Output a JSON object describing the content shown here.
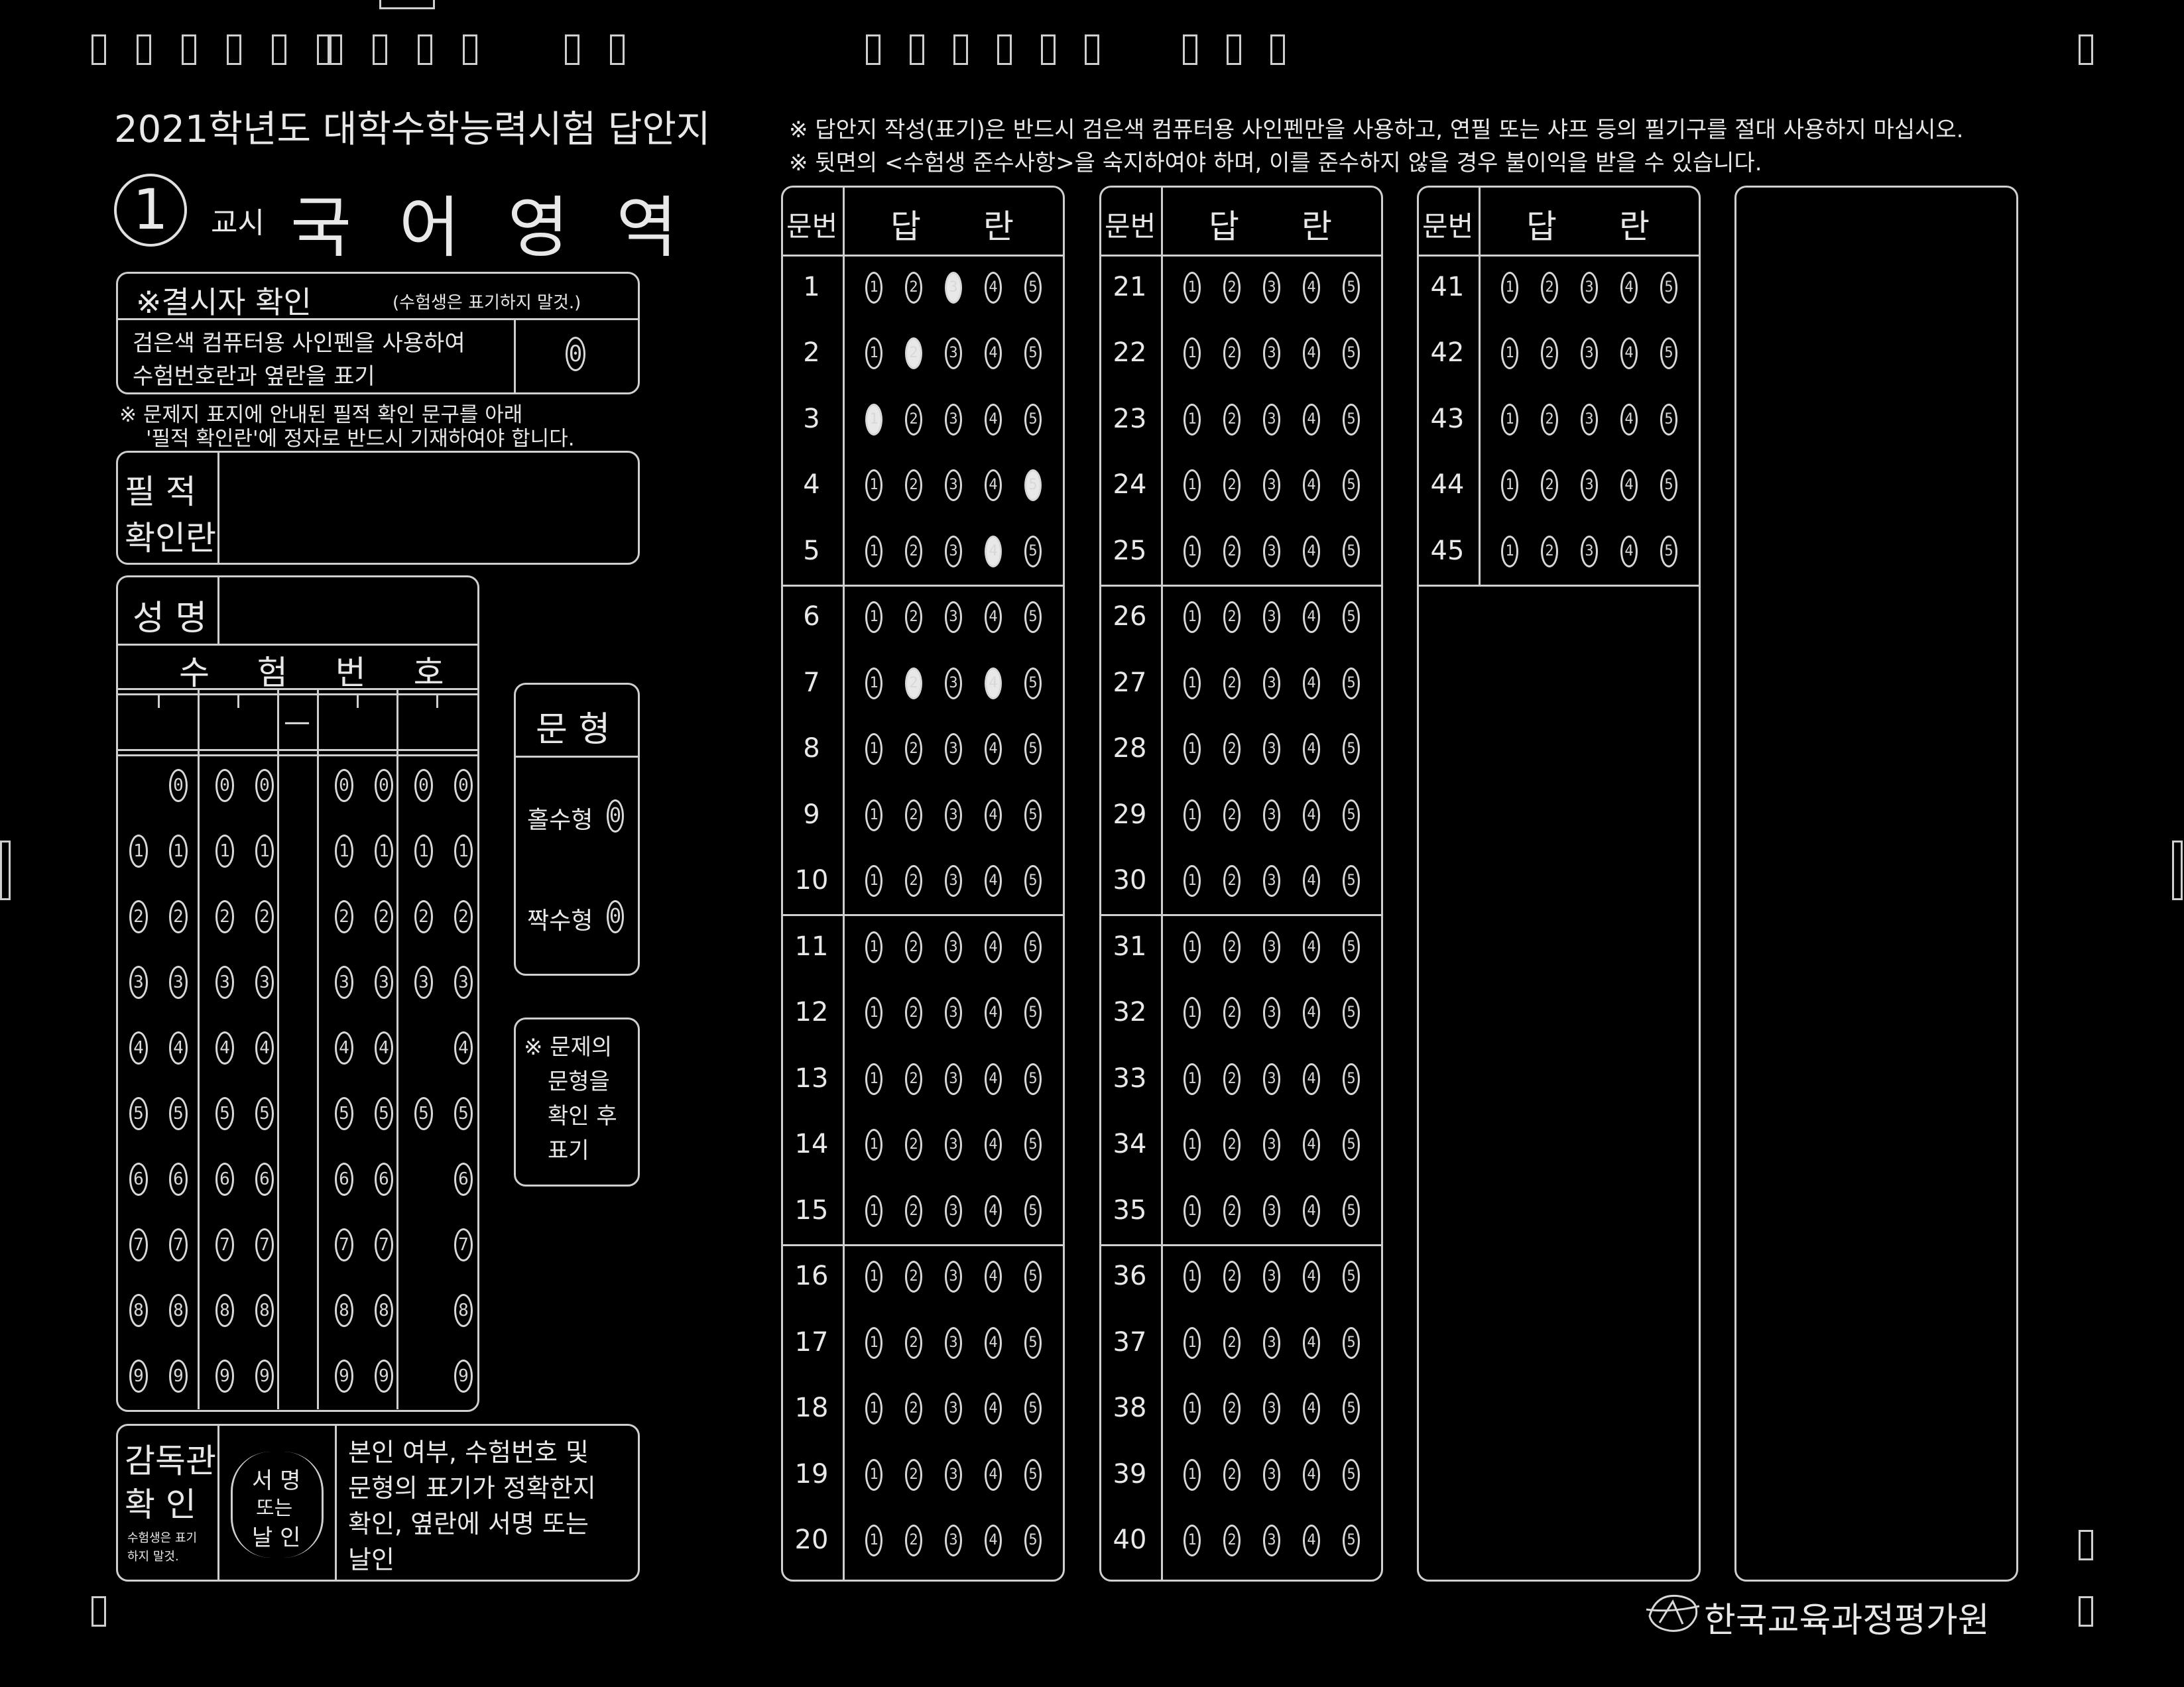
{
  "top_timing_marks": 21,
  "header": {
    "title": "2021학년도 대학수학능력시험 답안지",
    "period_number": "1",
    "period_label": "교시",
    "subject": "국 어 영 역"
  },
  "notices": [
    "※ 답안지 작성(표기)은 반드시 검은색 컴퓨터용 사인펜만을 사용하고, 연필 또는 샤프 등의 필기구를 절대 사용하지 마십시오.",
    "※ 뒷면의 <수험생 준수사항>을 숙지하여야 하며, 이를 준수하지 않을 경우 불이익을 받을 수 있습니다."
  ],
  "absence": {
    "title": "※결시자 확인",
    "note": "(수험생은 표기하지 말것.)",
    "instruction_line1": "검은색 컴퓨터용 사인펜을 사용하여",
    "instruction_line2": "수험번호란과 옆란을 표기",
    "bubble": "0"
  },
  "handwriting": {
    "notice_line1": "※ 문제지 표지에 안내된 필적 확인 문구를 아래",
    "notice_line2": "'필적 확인란'에 정자로 반드시 기재하여야 합니다.",
    "label_line1": "필  적",
    "label_line2": "확인란"
  },
  "name_label": "성  명",
  "exam_number": {
    "header": "수  험  번  호",
    "dash": "—",
    "digits": [
      "0",
      "1",
      "2",
      "3",
      "4",
      "5",
      "6",
      "7",
      "8",
      "9"
    ]
  },
  "type_box": {
    "title": "문  형",
    "odd_label": "홀수형",
    "even_label": "짝수형",
    "bubble": "0"
  },
  "type_notice": [
    "※ 문제의",
    "문형을",
    "확인 후",
    "표기"
  ],
  "supervisor": {
    "label_line1": "감독관",
    "label_line2": "확  인",
    "label_note_line1": "수험생은 표기",
    "label_note_line2": "하지 말것.",
    "sign_line1": "서 명",
    "sign_line2": "또는",
    "sign_line3": "날 인",
    "desc_lines": [
      "본인 여부, 수험번호 및",
      "문형의 표기가 정확한지",
      "확인, 옆란에 서명 또는",
      "날인"
    ]
  },
  "answer_sheet": {
    "col_header_number": "문번",
    "col_header_answer_a": "답",
    "col_header_answer_b": "란",
    "choices": [
      "1",
      "2",
      "3",
      "4",
      "5"
    ],
    "marked": {
      "1": 3,
      "2": 2,
      "3": 1,
      "4": 5,
      "5": 4,
      "7": [
        2,
        4
      ]
    }
  },
  "footer": {
    "org": "한국교육과정평가원"
  }
}
